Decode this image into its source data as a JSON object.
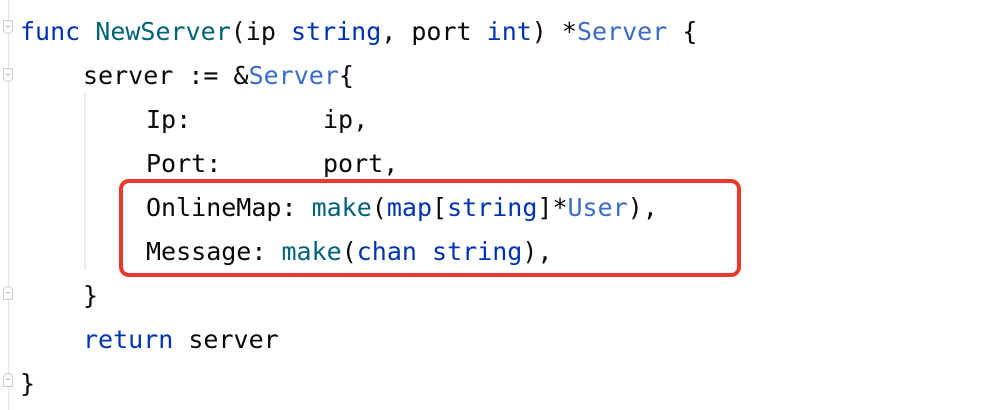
{
  "code": {
    "line1": {
      "kw_func": "func",
      "fn_name": "NewServer",
      "p_open": "(ip ",
      "t_string": "string",
      "p_mid": ", port ",
      "t_int": "int",
      "p_close": ") *",
      "t_server": "Server",
      "brace": " {"
    },
    "line2": {
      "lhs": "server := &",
      "t_server": "Server",
      "brace": "{"
    },
    "line3": {
      "key": "Ip:",
      "value": "ip,"
    },
    "line4": {
      "key": "Port:",
      "value": "port,"
    },
    "line5": {
      "key": "OnlineMap: ",
      "make": "make",
      "p1": "(",
      "kw_map": "map",
      "b1": "[",
      "t_string": "string",
      "b2": "]*",
      "t_user": "User",
      "end": "),"
    },
    "line6": {
      "key": "Message: ",
      "make": "make",
      "p1": "(",
      "kw_chan": "chan",
      "sp": " ",
      "t_string": "string",
      "end": "),"
    },
    "line7": {
      "brace": "}"
    },
    "line8": {
      "kw_return": "return",
      "rest": " server"
    },
    "line9": {
      "brace": "}"
    }
  },
  "colors": {
    "keyword": "#0033b3",
    "function": "#00627a",
    "type": "#3a6cc7",
    "text": "#080808",
    "highlight_border": "#e8392a"
  }
}
